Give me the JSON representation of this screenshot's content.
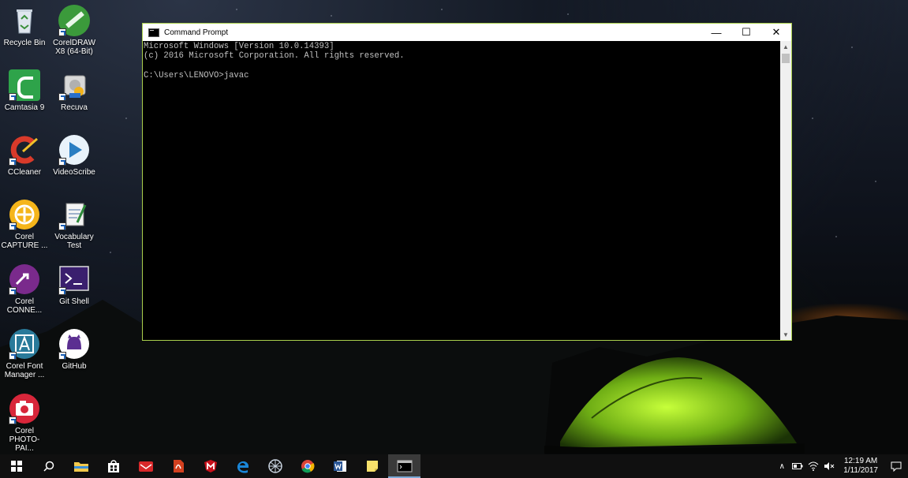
{
  "desktop": {
    "icons": [
      {
        "label": "Recycle Bin",
        "icon": "recycle-bin-icon"
      },
      {
        "label": "CorelDRAW X8 (64-Bit)",
        "icon": "coreldraw-icon"
      },
      {
        "label": "Camtasia 9",
        "icon": "camtasia-icon"
      },
      {
        "label": "Recuva",
        "icon": "recuva-icon"
      },
      {
        "label": "CCleaner",
        "icon": "ccleaner-icon"
      },
      {
        "label": "VideoScribe",
        "icon": "videoscribe-icon"
      },
      {
        "label": "Corel CAPTURE ...",
        "icon": "corel-capture-icon"
      },
      {
        "label": "Vocabulary Test",
        "icon": "vocabulary-test-icon"
      },
      {
        "label": "Corel CONNE...",
        "icon": "corel-connect-icon"
      },
      {
        "label": "Git Shell",
        "icon": "git-shell-icon"
      },
      {
        "label": "Corel Font Manager ...",
        "icon": "corel-font-manager-icon"
      },
      {
        "label": "GitHub",
        "icon": "github-icon"
      },
      {
        "label": "Corel PHOTO-PAI...",
        "icon": "corel-photo-paint-icon"
      }
    ]
  },
  "window": {
    "title": "Command Prompt",
    "controls": {
      "minimize": "—",
      "maximize": "☐",
      "close": "✕"
    },
    "console_text": "Microsoft Windows [Version 10.0.14393]\n(c) 2016 Microsoft Corporation. All rights reserved.\n\nC:\\Users\\LENOVO>javac",
    "accent_border": "#aacf4c"
  },
  "taskbar": {
    "apps": [
      "start-icon",
      "search-icon",
      "file-explorer-icon",
      "store-icon",
      "mail-icon",
      "pdf-icon",
      "mcafee-icon",
      "edge-icon",
      "network-app-icon",
      "chrome-icon",
      "word-icon",
      "sticky-notes-icon",
      "command-prompt-icon"
    ],
    "active_app": "command-prompt-icon",
    "clock": {
      "time": "12:19 AM",
      "date": "1/11/2017"
    }
  }
}
